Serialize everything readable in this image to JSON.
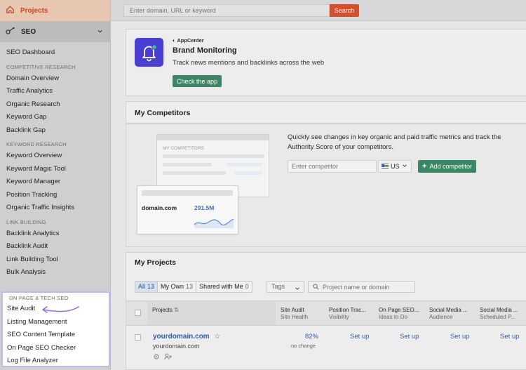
{
  "sidebar": {
    "projects_label": "Projects",
    "seo_label": "SEO",
    "dashboard": "SEO Dashboard",
    "sections": [
      {
        "heading": "COMPETITIVE RESEARCH",
        "items": [
          "Domain Overview",
          "Traffic Analytics",
          "Organic Research",
          "Keyword Gap",
          "Backlink Gap"
        ]
      },
      {
        "heading": "KEYWORD RESEARCH",
        "items": [
          "Keyword Overview",
          "Keyword Magic Tool",
          "Keyword Manager",
          "Position Tracking",
          "Organic Traffic Insights"
        ]
      },
      {
        "heading": "LINK BUILDING",
        "items": [
          "Backlink Analytics",
          "Backlink Audit",
          "Link Building Tool",
          "Bulk Analysis"
        ]
      },
      {
        "heading": "ON PAGE & TECH SEO",
        "items": [
          "Site Audit",
          "Listing Management",
          "SEO Content Template",
          "On Page SEO Checker",
          "Log File Analyzer"
        ]
      }
    ]
  },
  "topbar": {
    "search_placeholder": "Enter domain, URL or keyword",
    "search_button": "Search"
  },
  "brand_monitoring": {
    "appcenter": "AppCenter",
    "title": "Brand Monitoring",
    "description": "Track news mentions and backlinks across the web",
    "button": "Check the app"
  },
  "competitors": {
    "title": "My Competitors",
    "illustration_label": "MY COMPETITORS",
    "illustration_domain": "domain.com",
    "illustration_value": "291.5M",
    "description": "Quickly see changes in key organic and paid traffic metrics and track the Authority Score of your competitors.",
    "input_placeholder": "Enter competitor",
    "country": "US",
    "add_button": "Add competitor"
  },
  "projects": {
    "title": "My Projects",
    "filters": [
      {
        "label": "All",
        "count": "13",
        "active": true
      },
      {
        "label": "My Own",
        "count": "13",
        "active": false
      },
      {
        "label": "Shared with Me",
        "count": "0",
        "active": false
      }
    ],
    "tags_label": "Tags",
    "search_placeholder": "Project name or domain",
    "columns": [
      {
        "title": "Projects",
        "sub": ""
      },
      {
        "title": "Site Audit",
        "sub": "Site Health"
      },
      {
        "title": "Position Trac...",
        "sub": "Visibility"
      },
      {
        "title": "On Page SEO...",
        "sub": "Ideas to Do"
      },
      {
        "title": "Social Media ...",
        "sub": "Audience"
      },
      {
        "title": "Social Media ...",
        "sub": "Scheduled P..."
      }
    ],
    "rows": [
      {
        "domain": "yourdomain.com",
        "subdomain": "yourdomain.com",
        "site_health": "82%",
        "site_health_change": "no change",
        "setup_label": "Set up"
      }
    ]
  },
  "colors": {
    "accent_orange": "#d2502a",
    "green_button": "#3e8566",
    "link_blue": "#2e5fa8",
    "app_icon": "#4a3fd0",
    "highlight_border": "#c5b7ee"
  }
}
